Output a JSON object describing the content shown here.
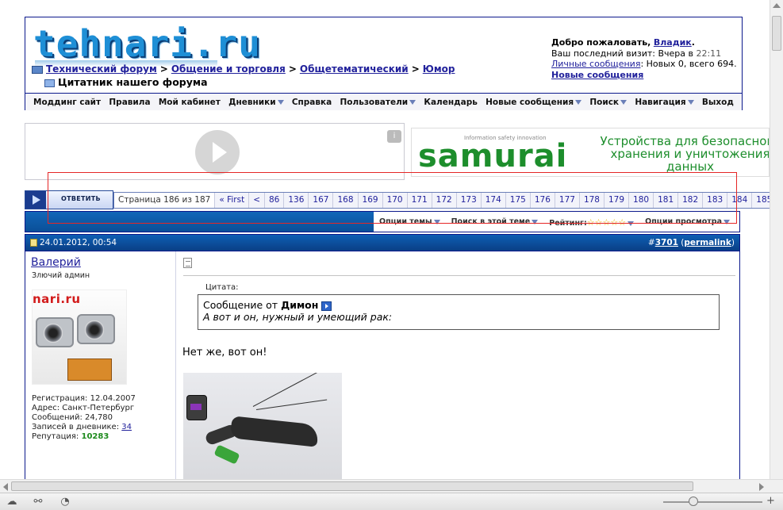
{
  "header": {
    "logo_text": "tehnari.ru",
    "breadcrumb": [
      "Технический форум",
      "Общение и торговля",
      "Общетематический",
      "Юмор"
    ],
    "breadcrumb_sep": ">",
    "current_thread": "Цитатник нашего форума"
  },
  "welcome": {
    "greeting_prefix": "Добро пожаловать,",
    "username": "Владик",
    "last_visit_prefix": "Ваш последний визит: Вчера в",
    "last_visit_time": "22:11",
    "pm_link": "Личные сообщения",
    "pm_counts": ": Новых 0, всего 694.",
    "new_posts_link": "Новые сообщения"
  },
  "navbar": [
    {
      "label": "Моддинг сайт",
      "dropdown": false
    },
    {
      "label": "Правила",
      "dropdown": false
    },
    {
      "label": "Мой кабинет",
      "dropdown": false
    },
    {
      "label": "Дневники",
      "dropdown": true
    },
    {
      "label": "Справка",
      "dropdown": false
    },
    {
      "label": "Пользователи",
      "dropdown": true
    },
    {
      "label": "Календарь",
      "dropdown": false
    },
    {
      "label": "Новые сообщения",
      "dropdown": true
    },
    {
      "label": "Поиск",
      "dropdown": true
    },
    {
      "label": "Навигация",
      "dropdown": true
    },
    {
      "label": "Выход",
      "dropdown": false
    }
  ],
  "ad": {
    "samurai_tagline": "Information safety innovation",
    "samurai_logo": "samurai",
    "samurai_text": "Устройства для безопасного хранения и уничтожения данных",
    "info_icon": "i"
  },
  "reply": {
    "label": "ОТВЕТИТЬ"
  },
  "pagination": {
    "label": "Страница 186 из 187",
    "first": "« First",
    "prev": "<",
    "pages": [
      "86",
      "136",
      "167",
      "168",
      "169",
      "170",
      "171",
      "172",
      "173",
      "174",
      "175",
      "176",
      "177",
      "178",
      "179",
      "180",
      "181",
      "182",
      "183",
      "184",
      "185"
    ],
    "current": "18"
  },
  "tools": {
    "thread_options": "Опции темы",
    "search_thread": "Поиск в этой теме",
    "rating": "Рейтинг:",
    "rating_stars": 5,
    "view_options": "Опции просмотра"
  },
  "post": {
    "date": "24.01.2012, 00:54",
    "number_prefix": "#",
    "number": "3701",
    "permalink": "permalink",
    "author": "Валерий",
    "author_title": "Злючий админ",
    "avatar_logo": "nari.ru",
    "registration": "Регистрация: 12.04.2007",
    "address": "Адрес: Санкт-Петербург",
    "posts": "Сообщений: 24,780",
    "diary_prefix": "Записей в дневнике:",
    "diary_count": "34",
    "reputation_prefix": "Репутация:",
    "reputation": "10283",
    "quote_label": "Цитата:",
    "quote_prefix": "Сообщение от",
    "quote_author": "Димон",
    "quote_text": "А вот и он, нужный и умеющий рак:",
    "text": "Нет же, вот он!"
  },
  "icons": {
    "status_bar": [
      "cloud-icon",
      "share-icon",
      "gauge-icon"
    ]
  },
  "colors": {
    "brand_blue": "#0b198c",
    "link": "#22229c",
    "samurai_green": "#1d8e2c",
    "highlight": "#e52626"
  }
}
